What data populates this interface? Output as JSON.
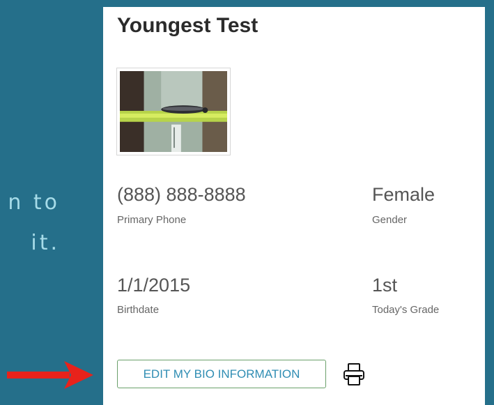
{
  "background_text": "n to\nit.",
  "profile": {
    "name": "Youngest Test",
    "phone": "(888) 888-8888",
    "phone_label": "Primary Phone",
    "gender": "Female",
    "gender_label": "Gender",
    "birthdate": "1/1/2015",
    "birthdate_label": "Birthdate",
    "grade": "1st",
    "grade_label": "Today's Grade"
  },
  "actions": {
    "edit_label": "EDIT MY BIO INFORMATION"
  },
  "icons": {
    "print": "printer-icon",
    "arrow": "red-arrow-pointer"
  },
  "colors": {
    "background": "#256f8a",
    "accent_text": "#2f8db3",
    "button_border": "#6aa06a",
    "arrow": "#e8221b"
  }
}
